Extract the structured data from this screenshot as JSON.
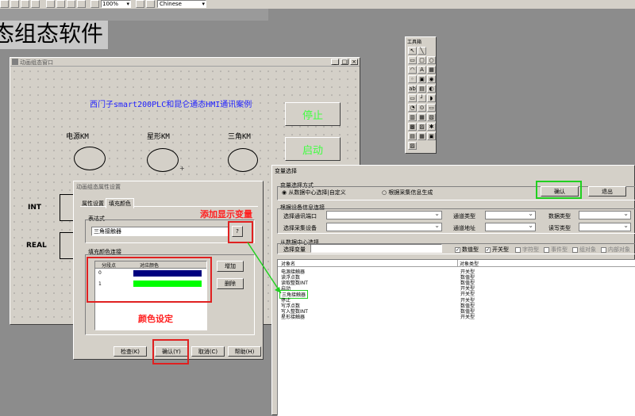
{
  "toolbar": {
    "zoom": "100%",
    "language": "Chinese"
  },
  "app_title_fragment": "态组态软件",
  "anim_window": {
    "title": "动画组态窗口",
    "caption": "西门子smart200PLC和昆仑通态HMI通讯案例",
    "labels": [
      "电源KM",
      "星形KM",
      "三角KM"
    ],
    "stop_button": "停止",
    "start_button": "启动",
    "side_labels": [
      "INT",
      "REAL"
    ]
  },
  "toolbox": {
    "title": "工具箱"
  },
  "props_dialog": {
    "title": "动画组态属性设置",
    "tabs": [
      "属性设置",
      "填充颜色"
    ],
    "expr_group": "表达式",
    "expr_value": "三角接触器",
    "expr_btn": "?",
    "fill_group": "填充颜色连接",
    "table_headers": [
      "分段点",
      "对应颜色"
    ],
    "rows": [
      {
        "point": "0",
        "color": "#00007f"
      },
      {
        "point": "1",
        "color": "#00ff00"
      }
    ],
    "add_btn": "增加",
    "delete_btn": "删除",
    "buttons": [
      "检查(K)",
      "确认(Y)",
      "取消(C)",
      "帮助(H)"
    ]
  },
  "annotations": {
    "add_var": "添加显示变量",
    "color_set": "颜色设定"
  },
  "var_dialog": {
    "title": "变量选择",
    "mode_group": "变量选择方式",
    "mode_options": [
      "从数据中心选择|自定义",
      "根据采集信息生成"
    ],
    "ok_btn": "确认",
    "exit_btn": "退出",
    "device_group": "根据设备信息连接",
    "device_labels": [
      "选择通讯端口",
      "通道类型",
      "数据类型",
      "选择采集设备",
      "通道地址",
      "读写类型"
    ],
    "center_group": "从数据中心选择",
    "select_var_label": "选择变量",
    "filters": [
      {
        "label": "数值型",
        "checked": true
      },
      {
        "label": "开关型",
        "checked": true
      },
      {
        "label": "字符型",
        "checked": false
      },
      {
        "label": "事件型",
        "checked": false
      },
      {
        "label": "组对象",
        "checked": false
      },
      {
        "label": "内部对象",
        "checked": false
      }
    ],
    "col_headers": [
      "对象名",
      "对象类型"
    ],
    "rows": [
      {
        "name": "电源接触器",
        "type": "开关型"
      },
      {
        "name": "读浮点数",
        "type": "数值型"
      },
      {
        "name": "读取整数INT",
        "type": "数值型"
      },
      {
        "name": "启动",
        "type": "开关型"
      },
      {
        "name": "三角接触器",
        "type": "开关型"
      },
      {
        "name": "停止",
        "type": "开关型"
      },
      {
        "name": "写浮点数",
        "type": "数值型"
      },
      {
        "name": "写入整数INT",
        "type": "数值型"
      },
      {
        "name": "星形接触器",
        "type": "开关型"
      }
    ]
  }
}
